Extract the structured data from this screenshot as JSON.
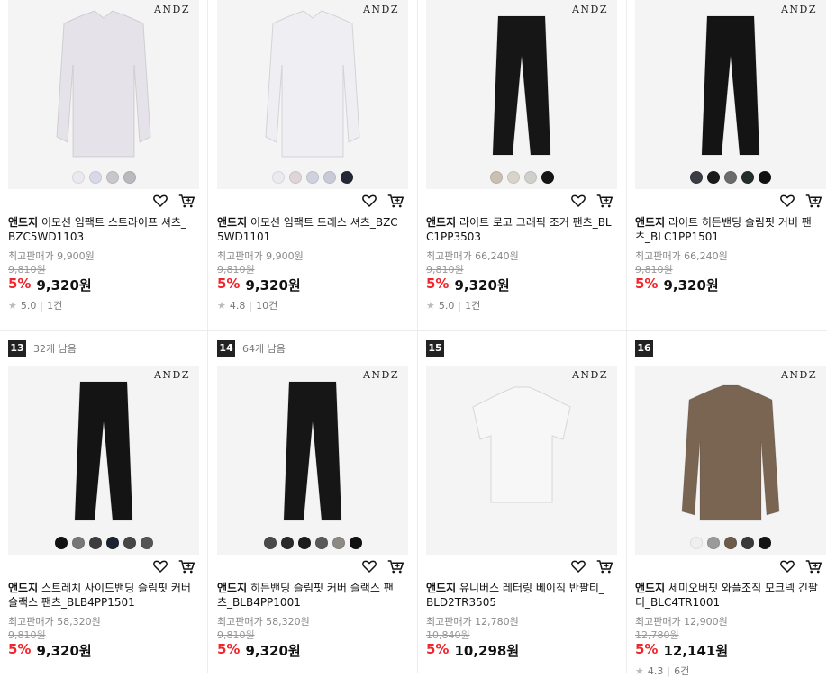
{
  "logo_text": "ANDZ",
  "colors": {
    "discount": "#f1252b"
  },
  "rows": [
    {
      "products": [
        {
          "rank": null,
          "left": null,
          "bg": "#f3f3f3",
          "garment": "shirt",
          "garment_color": "#e6e2ea",
          "swatches": [
            "#e9e9ef",
            "#d8d9e8",
            "#c7c7cc",
            "#b9babd"
          ],
          "brand": "앤드지",
          "name": "이모션 임팩트 스트라이프 셔츠_BZC5WD1103",
          "max_price_label": "최고판매가",
          "max_price": "9,900원",
          "original_price": "9,810원",
          "discount": "5%",
          "price": "9,320원",
          "rating": "5.0",
          "reviews": "1건"
        },
        {
          "rank": null,
          "left": null,
          "bg": "#f3f3f3",
          "garment": "shirt",
          "garment_color": "#eeeef3",
          "swatches": [
            "#eaeaf0",
            "#ddd5d8",
            "#cfd2dc",
            "#c8cbd6",
            "#242837"
          ],
          "brand": "앤드지",
          "name": "이모션 임팩트 드레스 셔츠_BZC5WD1101",
          "max_price_label": "최고판매가",
          "max_price": "9,900원",
          "original_price": "9,810원",
          "discount": "5%",
          "price": "9,320원",
          "rating": "4.8",
          "reviews": "10건"
        },
        {
          "rank": null,
          "left": null,
          "bg": "#f3f3f3",
          "garment": "pants",
          "garment_color": "#161616",
          "swatches": [
            "#c9bfb3",
            "#d8d4cc",
            "#d0cfcb",
            "#151515"
          ],
          "brand": "앤드지",
          "name": "라이트 로고 그래픽 조거 팬츠_BLC1PP3503",
          "max_price_label": "최고판매가",
          "max_price": "66,240원",
          "original_price": "9,810원",
          "discount": "5%",
          "price": "9,320원",
          "rating": "5.0",
          "reviews": "1건"
        },
        {
          "rank": null,
          "left": null,
          "bg": "#f3f3f3",
          "garment": "pants",
          "garment_color": "#141414",
          "swatches": [
            "#3a3d44",
            "#1a1a1a",
            "#6b6b6b",
            "#222e28",
            "#111111"
          ],
          "brand": "앤드지",
          "name": "라이트 히든밴딩 슬림핏 커버 팬츠_BLC1PP1501",
          "max_price_label": "최고판매가",
          "max_price": "66,240원",
          "original_price": "9,810원",
          "discount": "5%",
          "price": "9,320원",
          "rating": null,
          "reviews": null
        }
      ]
    },
    {
      "products": [
        {
          "rank": "13",
          "left": "32개 남음",
          "bg": "#f3f3f3",
          "garment": "pants",
          "garment_color": "#141414",
          "swatches": [
            "#121212",
            "#777777",
            "#3d3d3d",
            "#1d2230",
            "#464646",
            "#555555"
          ],
          "brand": "앤드지",
          "name": "스트레치 사이드밴딩 슬림핏 커버 슬랙스 팬츠_BLB4PP1501",
          "max_price_label": "최고판매가",
          "max_price": "58,320원",
          "original_price": "9,810원",
          "discount": "5%",
          "price": "9,320원",
          "rating": null,
          "reviews": null
        },
        {
          "rank": "14",
          "left": "64개 남음",
          "bg": "#f3f3f3",
          "garment": "pants",
          "garment_color": "#161616",
          "swatches": [
            "#4a4a4a",
            "#2a2a2a",
            "#1c1c1c",
            "#5a5a5a",
            "#8d8a84",
            "#111111"
          ],
          "brand": "앤드지",
          "name": "히든밴딩 슬림핏 커버 슬랙스 팬츠_BLB4PP1001",
          "max_price_label": "최고판매가",
          "max_price": "58,320원",
          "original_price": "9,810원",
          "discount": "5%",
          "price": "9,320원",
          "rating": null,
          "reviews": null
        },
        {
          "rank": "15",
          "left": null,
          "bg": "#f3f3f3",
          "garment": "tshirt",
          "garment_color": "#f7f7f7",
          "swatches": [],
          "brand": "앤드지",
          "name": "유니버스 레터링 베이직 반팔티_BLD2TR3505",
          "max_price_label": "최고판매가",
          "max_price": "12,780원",
          "original_price": "10,840원",
          "discount": "5%",
          "price": "10,298원",
          "rating": null,
          "reviews": null
        },
        {
          "rank": "16",
          "left": null,
          "bg": "#f3f3f3",
          "garment": "knit",
          "garment_color": "#7a6553",
          "swatches": [
            "#efefef",
            "#9a9a9a",
            "#6d5b4c",
            "#3a3a3a",
            "#141414"
          ],
          "brand": "앤드지",
          "name": "세미오버핏 와플조직 모크넥 긴팔티_BLC4TR1001",
          "max_price_label": "최고판매가",
          "max_price": "12,900원",
          "original_price": "12,780원",
          "discount": "5%",
          "price": "12,141원",
          "rating": "4.3",
          "reviews": "6건"
        }
      ]
    }
  ]
}
